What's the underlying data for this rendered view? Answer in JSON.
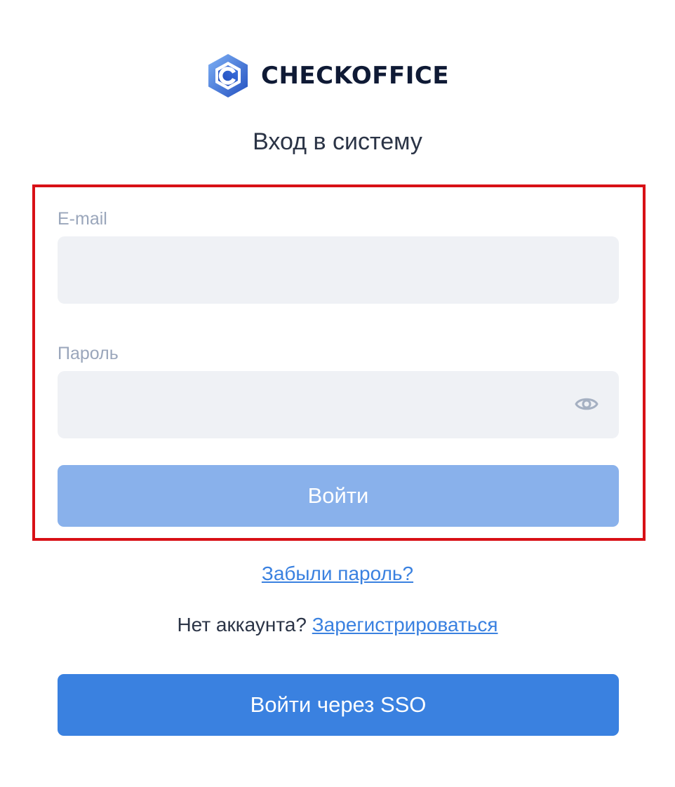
{
  "brand": {
    "name": "CHECKOFFICE",
    "logo_icon": "checkoffice-hex-logo-icon",
    "colors": {
      "hex_light": "#5b8de8",
      "hex_dark": "#2c5ec8",
      "text": "#0f1a35"
    }
  },
  "page": {
    "title": "Вход в систему"
  },
  "form": {
    "email": {
      "label": "E-mail",
      "value": "",
      "placeholder": ""
    },
    "password": {
      "label": "Пароль",
      "value": "",
      "placeholder": "",
      "toggle_icon": "eye-icon"
    },
    "submit_label": "Войти",
    "highlight_color": "#d81016"
  },
  "links": {
    "forgot_password": "Забыли пароль?",
    "no_account_text": "Нет аккаунта?",
    "register": "Зарегистрироваться"
  },
  "sso": {
    "label": "Войти через SSO"
  },
  "colors": {
    "primary": "#3a81e0",
    "primary_disabled": "#89b1eb",
    "field_bg": "#eff1f5",
    "label_text": "#9aa6bb",
    "body_text": "#2b3446"
  }
}
